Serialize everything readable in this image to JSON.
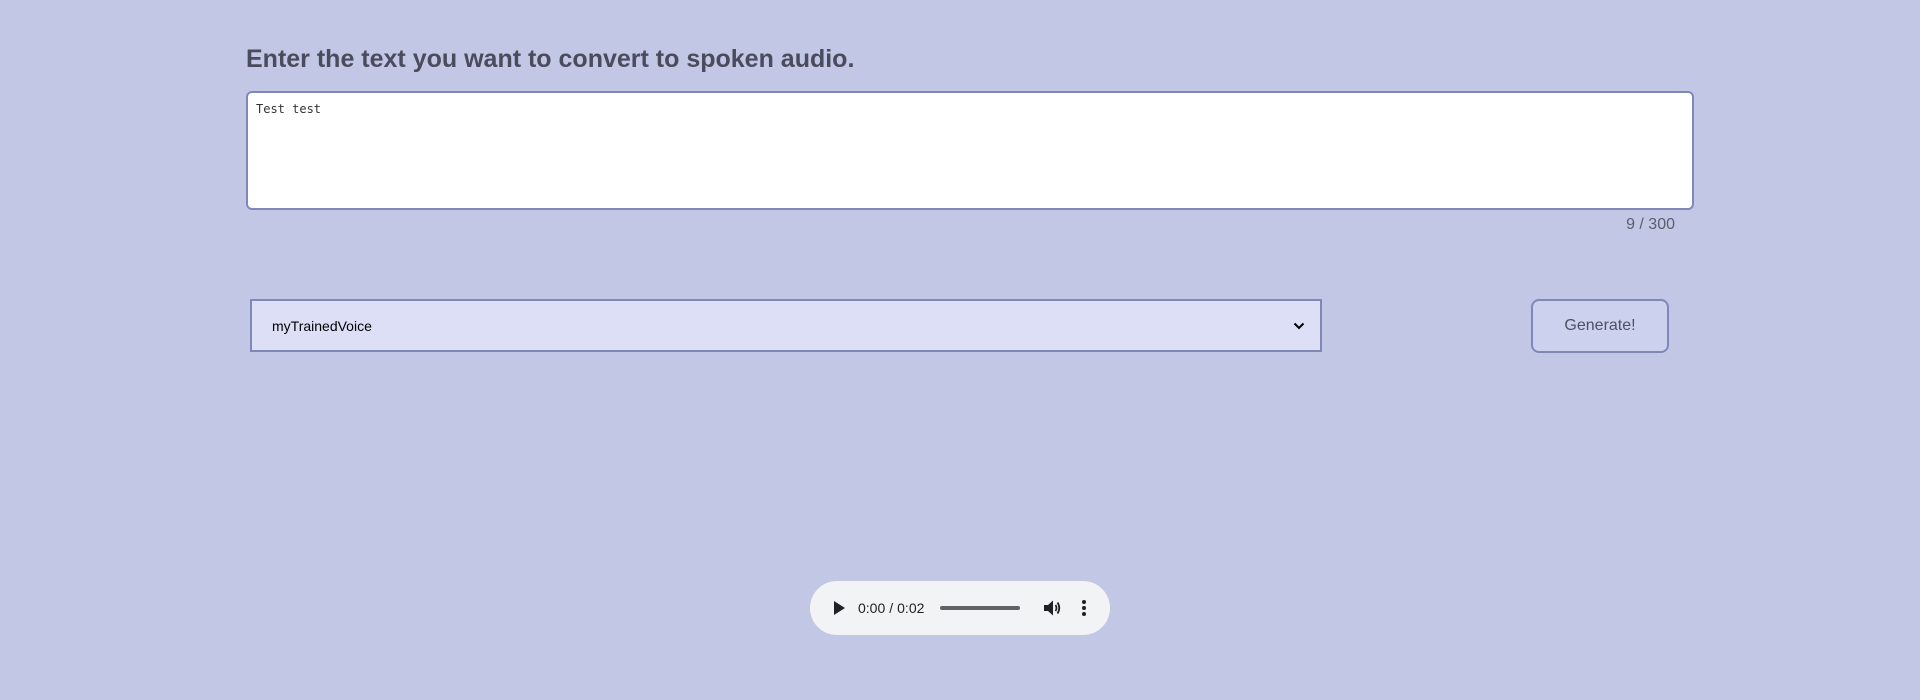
{
  "form": {
    "heading": "Enter the text you want to convert to spoken audio.",
    "text_value": "Test test",
    "char_count": "9 / 300"
  },
  "voice_select": {
    "selected": "myTrainedVoice",
    "icon": "chevron-down-icon"
  },
  "generate_button": {
    "label": "Generate!"
  },
  "audio_player": {
    "current_time": "0:00",
    "separator": "/",
    "duration": "0:02",
    "progress": 0,
    "icons": {
      "play": "play-icon",
      "volume": "volume-icon",
      "more": "more-options-icon"
    }
  }
}
